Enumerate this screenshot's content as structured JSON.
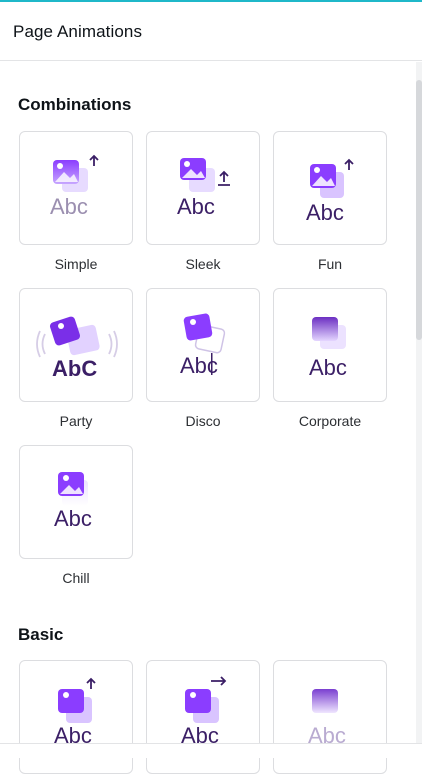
{
  "header": {
    "title": "Page Animations"
  },
  "sections": [
    {
      "title": "Combinations"
    },
    {
      "title": "Basic"
    }
  ],
  "combinations": [
    {
      "label": "Simple"
    },
    {
      "label": "Sleek"
    },
    {
      "label": "Fun"
    },
    {
      "label": "Party"
    },
    {
      "label": "Disco"
    },
    {
      "label": "Corporate"
    },
    {
      "label": "Chill"
    }
  ],
  "preview_text": "Abc",
  "party_text": "AbC",
  "colors": {
    "accent": "#8b3dff",
    "accent_light": "#c7a6ff",
    "text_dark": "#3b1f66",
    "divider": "#e3e4e6"
  },
  "icons": [
    "image-icon",
    "arrow-up-icon",
    "arrow-right-icon",
    "upload-arrow-icon"
  ]
}
